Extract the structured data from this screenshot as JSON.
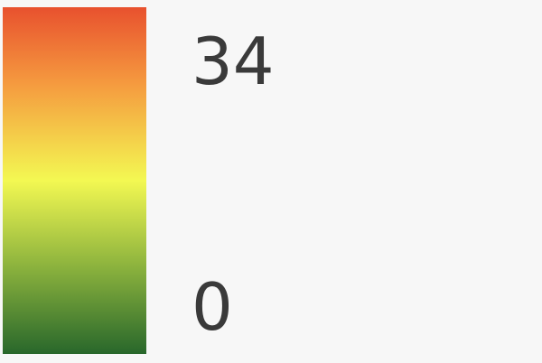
{
  "legend": {
    "max_label": "34",
    "min_label": "0",
    "gradient_colors": {
      "top": "#e8512e",
      "upper_middle": "#f59a3f",
      "middle": "#f3f852",
      "lower_middle": "#8fb53e",
      "bottom": "#28672b"
    }
  }
}
